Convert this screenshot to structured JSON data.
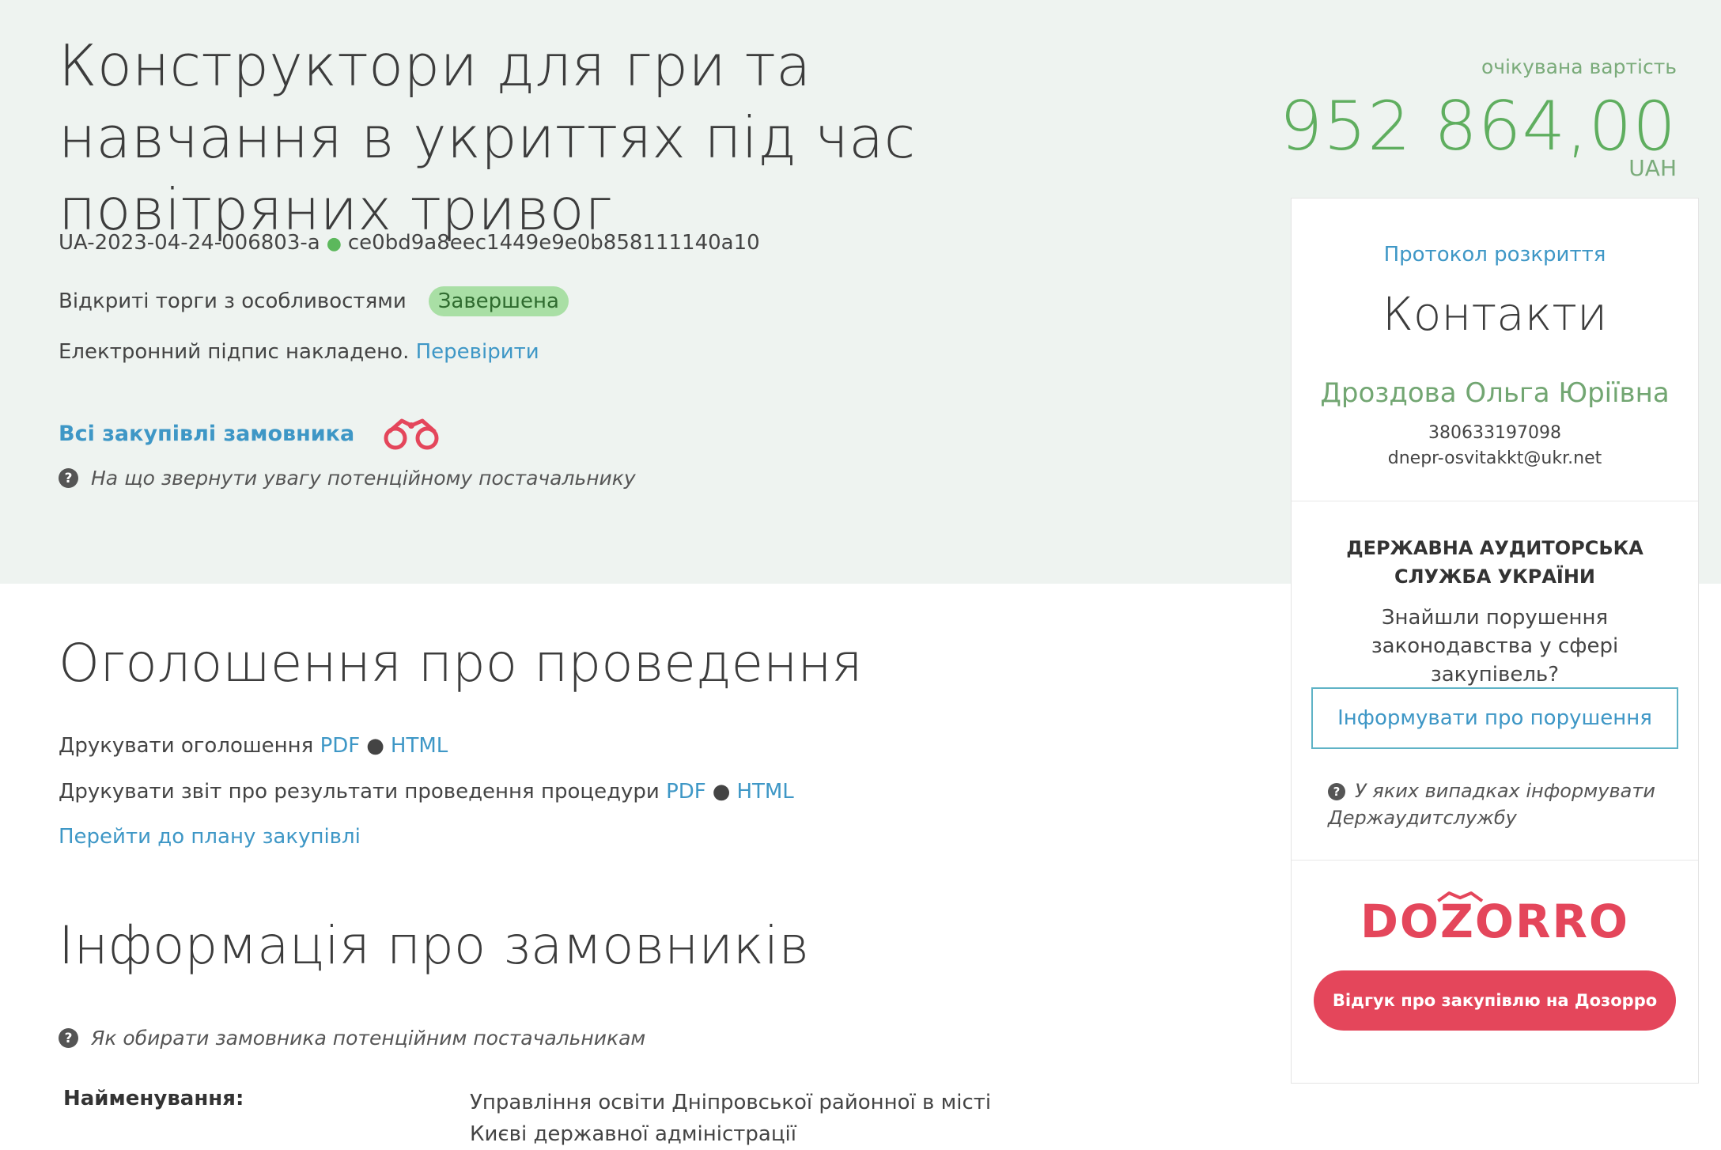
{
  "tender": {
    "title": "Конструктори для гри та навчання в укриттях під час повітряних тривог",
    "id": "UA-2023-04-24-006803-a",
    "hash": "ce0bd9a8eec1449e9e0b858111140a10",
    "procedure_type": "Відкриті торги з особливостями",
    "status": "Завершена",
    "signature_text": "Електронний підпис накладено.",
    "signature_link": "Перевірити",
    "all_purchases_link": "Всі закупівлі замовника",
    "supplier_hint": "На що звернути увагу потенційному постачальнику"
  },
  "price": {
    "label": "очікувана вартість",
    "value": "952 864,00",
    "currency": "UAH"
  },
  "announcement": {
    "title": "Оголошення про проведення",
    "print_announcement": "Друкувати оголошення",
    "print_report": "Друкувати звіт про результати проведення процедури",
    "pdf": "PDF",
    "html": "HTML",
    "plan_link": "Перейти до плану закупівлі"
  },
  "customers": {
    "title": "Інформація про замовників",
    "hint": "Як обирати замовника потенційним постачальникам",
    "name_label": "Найменування:",
    "name_value": "Управління освіти Дніпровської районної в місті Києві державної адміністрації"
  },
  "sidebar": {
    "protocol_link": "Протокол розкриття",
    "contacts_title": "Контакти",
    "contact_name": "Дроздова Ольга Юріївна",
    "contact_phone": "380633197098",
    "contact_email": "dnepr-osvitakkt@ukr.net",
    "audit_title": "ДЕРЖАВНА АУДИТОРСЬКА СЛУЖБА УКРАЇНИ",
    "audit_text": "Знайшли порушення законодавства у сфері закупівель?",
    "report_button": "Інформувати про порушення",
    "audit_hint": "У яких випадках інформувати Держаудитслужбу",
    "dozorro_logo": "DOZORRO",
    "dozorro_button": "Відгук про закупівлю на Дозорро"
  },
  "colors": {
    "top_band": "#eef3f0",
    "link": "#3e97c6",
    "price_green": "#5fae5f",
    "status_badge": "#a9dfa5",
    "dozorro_red": "#e4465b"
  },
  "icons": {
    "binoculars": "binoculars-icon",
    "question": "question-circle-icon"
  }
}
